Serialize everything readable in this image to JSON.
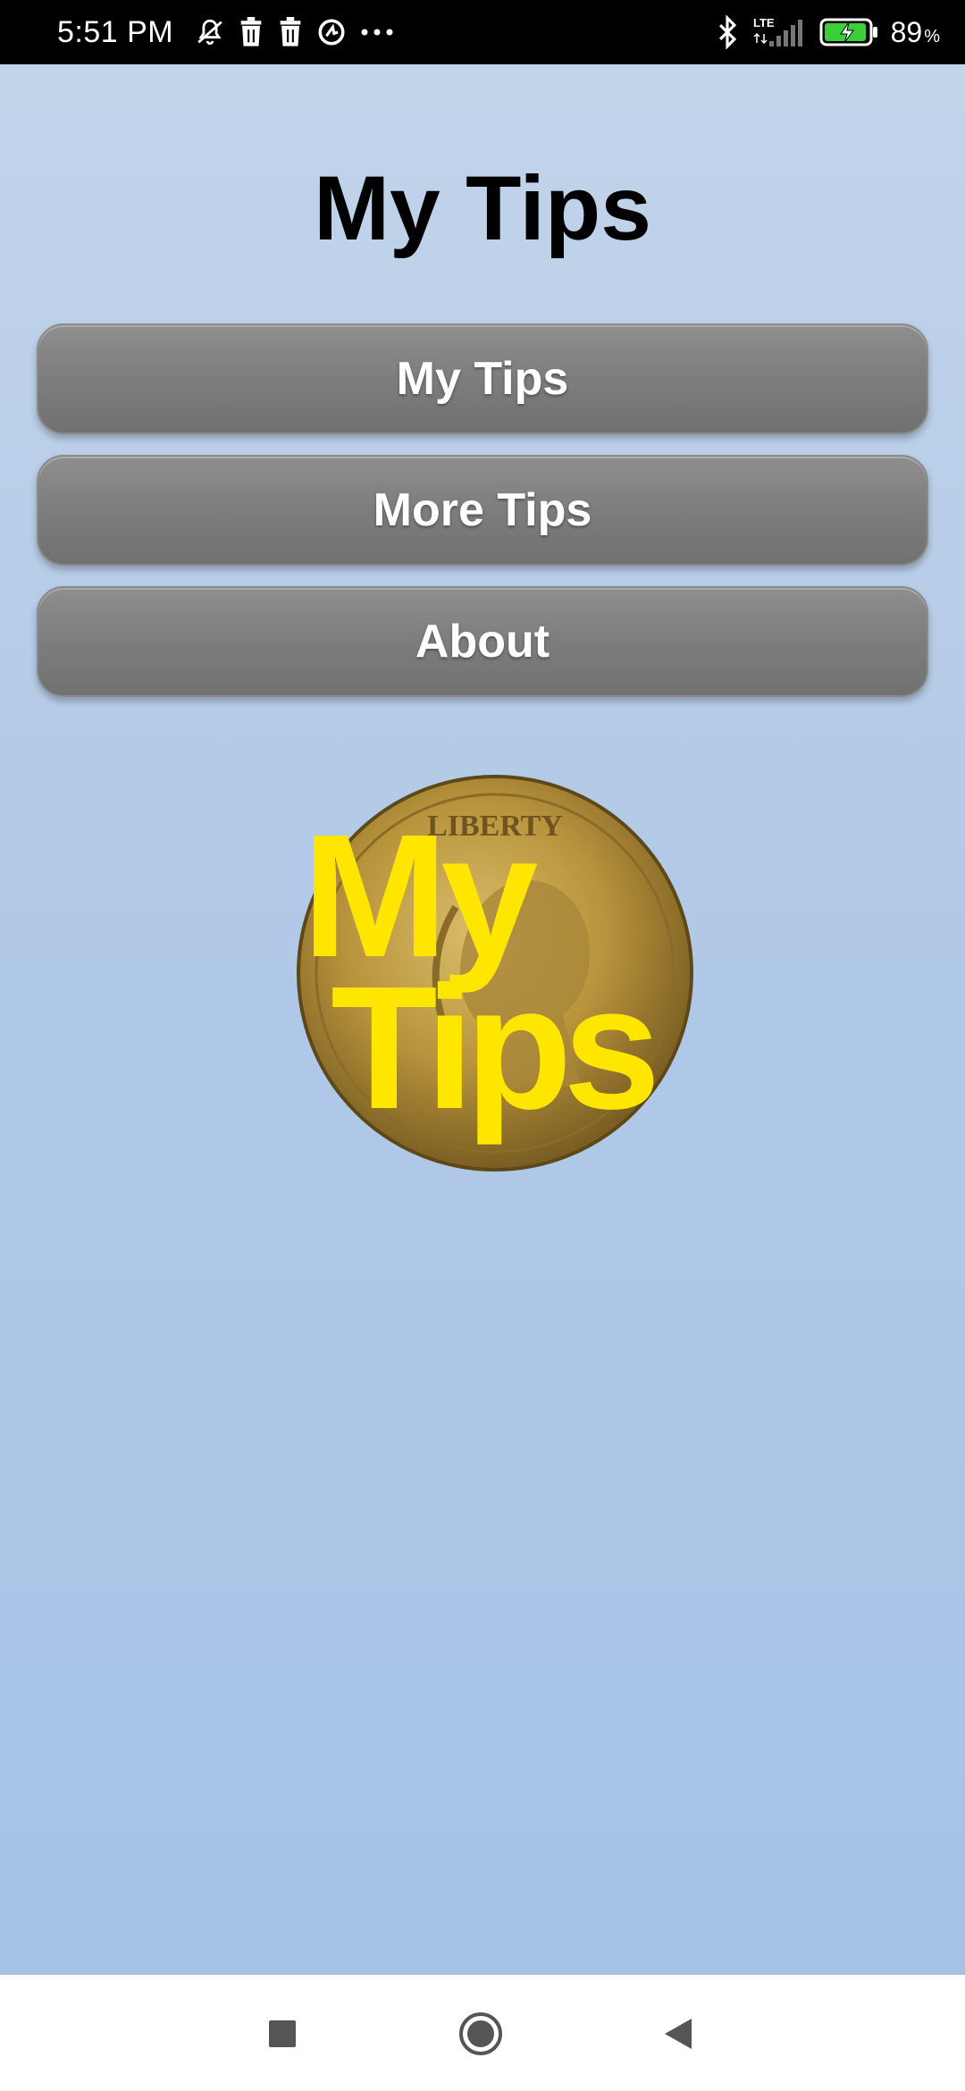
{
  "status_bar": {
    "time": "5:51 PM",
    "left_icons": [
      "notifications-off-icon",
      "trash-icon",
      "trash-icon",
      "data-saver-icon",
      "more-dots-icon"
    ],
    "right_icons": [
      "bluetooth-icon",
      "lte-signal-icon",
      "battery-charging-icon"
    ],
    "network_label": "LTE",
    "battery_percent": "89",
    "battery_unit": "%"
  },
  "app": {
    "title": "My Tips",
    "buttons": [
      {
        "label": "My Tips"
      },
      {
        "label": "More Tips"
      },
      {
        "label": "About"
      }
    ],
    "logo": {
      "line1": "My",
      "line2": "Tips",
      "coin_text": "LIBERTY",
      "text_color": "#ffe600",
      "coin_color": "#b8943c"
    }
  },
  "colors": {
    "background_top": "#c2d4ea",
    "background_bottom": "#a5c2e5",
    "button": "#7d7d7d",
    "title": "#000000"
  },
  "nav_bar": {
    "buttons": [
      "recents-square-icon",
      "home-circle-icon",
      "back-triangle-icon"
    ]
  }
}
